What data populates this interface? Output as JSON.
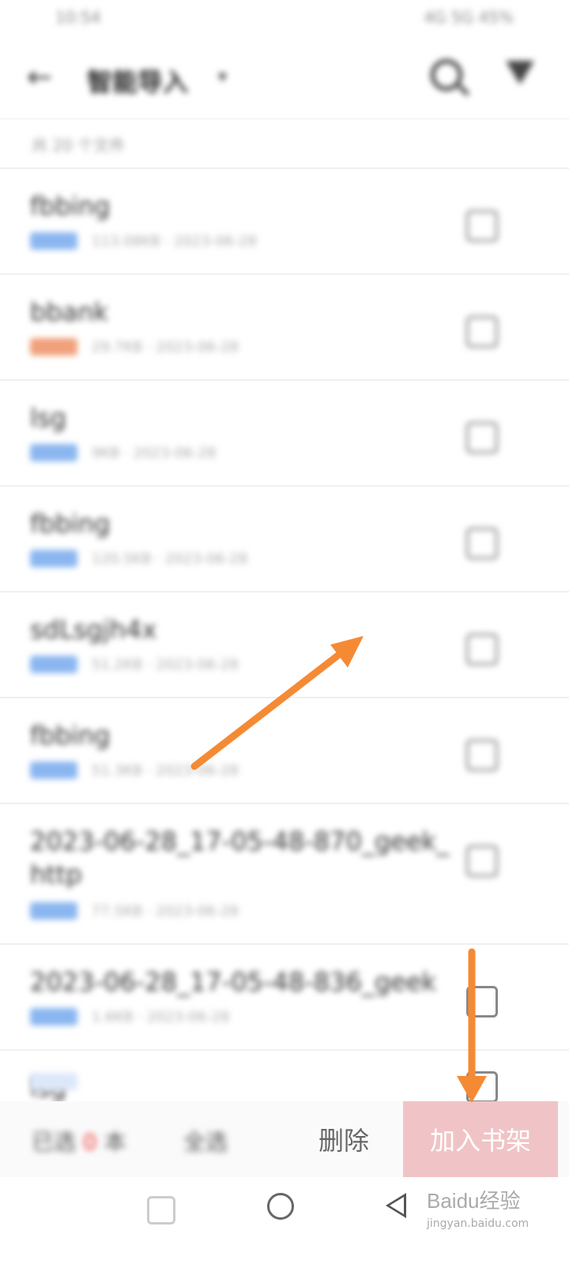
{
  "status_bar": {
    "time": "10:54",
    "icons": "4G 5G 45%"
  },
  "header": {
    "back_icon": "arrow-left-icon",
    "title": "智能导入",
    "caret_icon": "caret-down-icon",
    "search_icon": "search-icon",
    "filter_icon": "filter-icon"
  },
  "summary": "共 20 个文件",
  "items": [
    {
      "name": "fbbing",
      "tag_color": "#8ab6f0",
      "info": "113.08KB · 2023-06-28"
    },
    {
      "name": "bbank",
      "tag_color": "#f0a07a",
      "info": "29.7KB · 2023-06-28"
    },
    {
      "name": "lsg",
      "tag_color": "#8ab6f0",
      "info": "9KB · 2023-06-28"
    },
    {
      "name": "fbbing",
      "tag_color": "#8ab6f0",
      "info": "120.5KB · 2023-06-28"
    },
    {
      "name": "sdLsgjh4x",
      "tag_color": "#8ab6f0",
      "info": "51.2KB · 2023-06-28"
    },
    {
      "name": "fbbing",
      "tag_color": "#8ab6f0",
      "info": "51.3KB · 2023-06-28"
    },
    {
      "name": "2023-06-28_17-05-48-870_geek_http",
      "tag_color": "#8ab6f0",
      "info": "77.5KB · 2023-06-28"
    },
    {
      "name": "2023-06-28_17-05-48-836_geek",
      "tag_color": "#8ab6f0",
      "info": "1.6KB · 2023-06-28"
    },
    {
      "name": "lsg",
      "tag_color": "#dce8fa",
      "info": ""
    }
  ],
  "bottom": {
    "selected_prefix": "已选",
    "selected_count": "0",
    "selected_suffix": "本",
    "select_all": "全选",
    "delete": "删除",
    "add_to_shelf": "加入书架"
  },
  "nav": {
    "recent_icon": "recent-apps-icon",
    "home_icon": "home-icon",
    "back_icon": "back-triangle-icon"
  },
  "watermark": {
    "brand": "Baidu经验",
    "site": "jingyan.baidu.com"
  },
  "annotation_colors": {
    "arrow": "#f58a34"
  }
}
